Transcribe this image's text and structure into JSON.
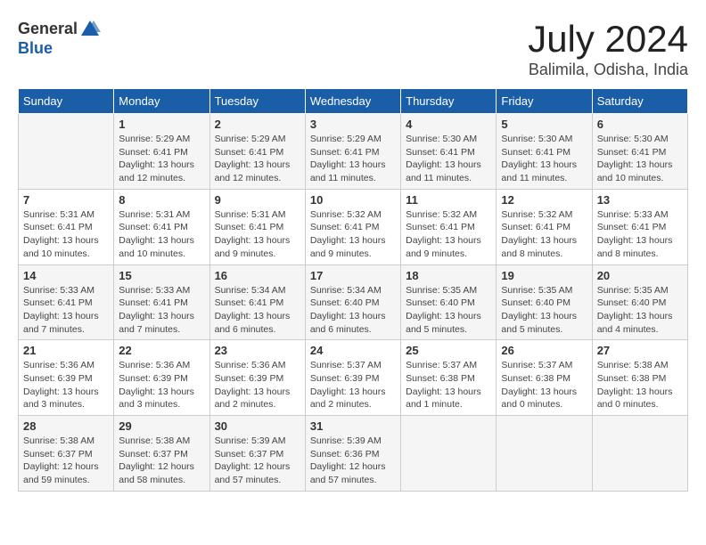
{
  "header": {
    "logo_general": "General",
    "logo_blue": "Blue",
    "month": "July 2024",
    "location": "Balimila, Odisha, India"
  },
  "columns": [
    "Sunday",
    "Monday",
    "Tuesday",
    "Wednesday",
    "Thursday",
    "Friday",
    "Saturday"
  ],
  "weeks": [
    [
      {
        "day": "",
        "info": ""
      },
      {
        "day": "1",
        "info": "Sunrise: 5:29 AM\nSunset: 6:41 PM\nDaylight: 13 hours\nand 12 minutes."
      },
      {
        "day": "2",
        "info": "Sunrise: 5:29 AM\nSunset: 6:41 PM\nDaylight: 13 hours\nand 12 minutes."
      },
      {
        "day": "3",
        "info": "Sunrise: 5:29 AM\nSunset: 6:41 PM\nDaylight: 13 hours\nand 11 minutes."
      },
      {
        "day": "4",
        "info": "Sunrise: 5:30 AM\nSunset: 6:41 PM\nDaylight: 13 hours\nand 11 minutes."
      },
      {
        "day": "5",
        "info": "Sunrise: 5:30 AM\nSunset: 6:41 PM\nDaylight: 13 hours\nand 11 minutes."
      },
      {
        "day": "6",
        "info": "Sunrise: 5:30 AM\nSunset: 6:41 PM\nDaylight: 13 hours\nand 10 minutes."
      }
    ],
    [
      {
        "day": "7",
        "info": "Sunrise: 5:31 AM\nSunset: 6:41 PM\nDaylight: 13 hours\nand 10 minutes."
      },
      {
        "day": "8",
        "info": "Sunrise: 5:31 AM\nSunset: 6:41 PM\nDaylight: 13 hours\nand 10 minutes."
      },
      {
        "day": "9",
        "info": "Sunrise: 5:31 AM\nSunset: 6:41 PM\nDaylight: 13 hours\nand 9 minutes."
      },
      {
        "day": "10",
        "info": "Sunrise: 5:32 AM\nSunset: 6:41 PM\nDaylight: 13 hours\nand 9 minutes."
      },
      {
        "day": "11",
        "info": "Sunrise: 5:32 AM\nSunset: 6:41 PM\nDaylight: 13 hours\nand 9 minutes."
      },
      {
        "day": "12",
        "info": "Sunrise: 5:32 AM\nSunset: 6:41 PM\nDaylight: 13 hours\nand 8 minutes."
      },
      {
        "day": "13",
        "info": "Sunrise: 5:33 AM\nSunset: 6:41 PM\nDaylight: 13 hours\nand 8 minutes."
      }
    ],
    [
      {
        "day": "14",
        "info": "Sunrise: 5:33 AM\nSunset: 6:41 PM\nDaylight: 13 hours\nand 7 minutes."
      },
      {
        "day": "15",
        "info": "Sunrise: 5:33 AM\nSunset: 6:41 PM\nDaylight: 13 hours\nand 7 minutes."
      },
      {
        "day": "16",
        "info": "Sunrise: 5:34 AM\nSunset: 6:41 PM\nDaylight: 13 hours\nand 6 minutes."
      },
      {
        "day": "17",
        "info": "Sunrise: 5:34 AM\nSunset: 6:40 PM\nDaylight: 13 hours\nand 6 minutes."
      },
      {
        "day": "18",
        "info": "Sunrise: 5:35 AM\nSunset: 6:40 PM\nDaylight: 13 hours\nand 5 minutes."
      },
      {
        "day": "19",
        "info": "Sunrise: 5:35 AM\nSunset: 6:40 PM\nDaylight: 13 hours\nand 5 minutes."
      },
      {
        "day": "20",
        "info": "Sunrise: 5:35 AM\nSunset: 6:40 PM\nDaylight: 13 hours\nand 4 minutes."
      }
    ],
    [
      {
        "day": "21",
        "info": "Sunrise: 5:36 AM\nSunset: 6:39 PM\nDaylight: 13 hours\nand 3 minutes."
      },
      {
        "day": "22",
        "info": "Sunrise: 5:36 AM\nSunset: 6:39 PM\nDaylight: 13 hours\nand 3 minutes."
      },
      {
        "day": "23",
        "info": "Sunrise: 5:36 AM\nSunset: 6:39 PM\nDaylight: 13 hours\nand 2 minutes."
      },
      {
        "day": "24",
        "info": "Sunrise: 5:37 AM\nSunset: 6:39 PM\nDaylight: 13 hours\nand 2 minutes."
      },
      {
        "day": "25",
        "info": "Sunrise: 5:37 AM\nSunset: 6:38 PM\nDaylight: 13 hours\nand 1 minute."
      },
      {
        "day": "26",
        "info": "Sunrise: 5:37 AM\nSunset: 6:38 PM\nDaylight: 13 hours\nand 0 minutes."
      },
      {
        "day": "27",
        "info": "Sunrise: 5:38 AM\nSunset: 6:38 PM\nDaylight: 13 hours\nand 0 minutes."
      }
    ],
    [
      {
        "day": "28",
        "info": "Sunrise: 5:38 AM\nSunset: 6:37 PM\nDaylight: 12 hours\nand 59 minutes."
      },
      {
        "day": "29",
        "info": "Sunrise: 5:38 AM\nSunset: 6:37 PM\nDaylight: 12 hours\nand 58 minutes."
      },
      {
        "day": "30",
        "info": "Sunrise: 5:39 AM\nSunset: 6:37 PM\nDaylight: 12 hours\nand 57 minutes."
      },
      {
        "day": "31",
        "info": "Sunrise: 5:39 AM\nSunset: 6:36 PM\nDaylight: 12 hours\nand 57 minutes."
      },
      {
        "day": "",
        "info": ""
      },
      {
        "day": "",
        "info": ""
      },
      {
        "day": "",
        "info": ""
      }
    ]
  ]
}
